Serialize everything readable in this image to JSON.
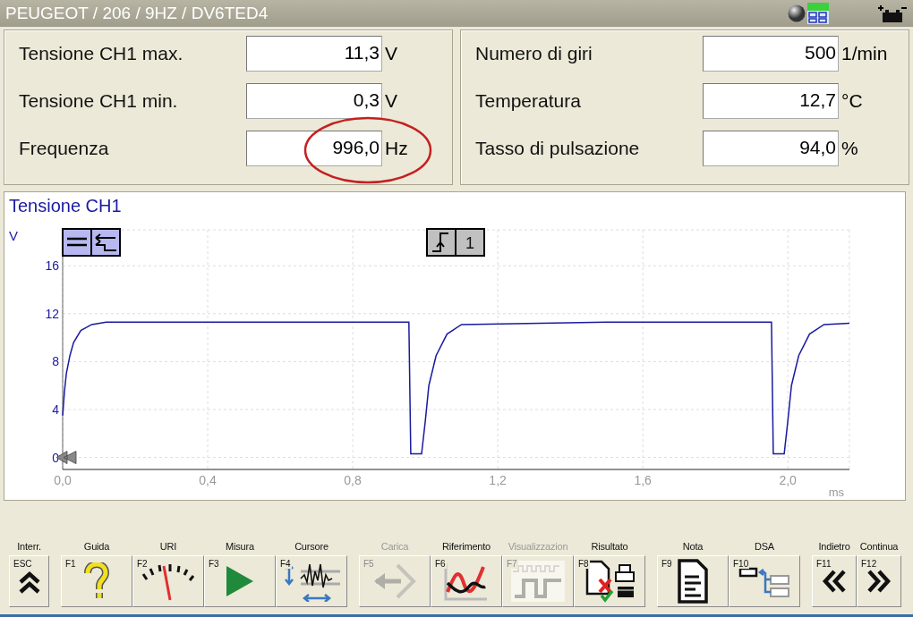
{
  "window": {
    "title": "PEUGEOT / 206 / 9HZ / DV6TED4"
  },
  "readings": [
    {
      "label": "Tensione CH1 max.",
      "value": "11,3",
      "unit": "V",
      "highlighted": false
    },
    {
      "label": "Tensione CH1 min.",
      "value": "0,3",
      "unit": "V",
      "highlighted": false
    },
    {
      "label": "Frequenza",
      "value": "996,0",
      "unit": "Hz",
      "highlighted": true
    },
    {
      "label": "Numero di giri",
      "value": "500",
      "unit": "1/min",
      "highlighted": false
    },
    {
      "label": "Temperatura",
      "value": "12,7",
      "unit": "°C",
      "highlighted": false
    },
    {
      "label": "Tasso di pulsazione",
      "value": "94,0",
      "unit": "%",
      "highlighted": false
    }
  ],
  "chart": {
    "trigger_channel": "1",
    "chart_data": {
      "type": "line",
      "title": "Tensione CH1",
      "xlabel": "ms",
      "ylabel": "V",
      "x": [
        0,
        0.005,
        0.01,
        0.02,
        0.03,
        0.05,
        0.08,
        0.12,
        0.5,
        0.95,
        0.955,
        0.96,
        0.98,
        0.99,
        1.0,
        1.01,
        1.03,
        1.06,
        1.1,
        1.5,
        1.955,
        1.96,
        1.98,
        1.99,
        2.0,
        2.01,
        2.03,
        2.06,
        2.1,
        2.17
      ],
      "grid": true,
      "series": [
        {
          "color": "#1a1aa0",
          "values": [
            3.5,
            5.5,
            7,
            8.5,
            9.6,
            10.6,
            11.1,
            11.3,
            11.3,
            11.3,
            11.3,
            0.3,
            0.3,
            0.3,
            3,
            6,
            8.5,
            10.3,
            11.1,
            11.3,
            11.3,
            0.3,
            0.3,
            0.3,
            3,
            6,
            8.5,
            10.3,
            11.1,
            11.2
          ]
        }
      ],
      "xlim": [
        0,
        2.17
      ],
      "ylim": [
        -1,
        19
      ],
      "xticks": [
        {
          "value": 0,
          "label": "0,0"
        },
        {
          "value": 0.4,
          "label": "0,4"
        },
        {
          "value": 0.8,
          "label": "0,8"
        },
        {
          "value": 1.2,
          "label": "1,2"
        },
        {
          "value": 1.6,
          "label": "1,6"
        },
        {
          "value": 2.0,
          "label": "2,0"
        }
      ],
      "yticks": [
        0,
        4,
        8,
        12,
        16
      ]
    }
  },
  "function_keys": [
    [
      {
        "label": "Interr.",
        "key": "ESC",
        "disabled": false
      }
    ],
    [
      {
        "label": "Guida",
        "key": "F1",
        "disabled": false
      },
      {
        "label": "URI",
        "key": "F2",
        "disabled": false
      },
      {
        "label": "Misura",
        "key": "F3",
        "disabled": false
      },
      {
        "label": "Cursore",
        "key": "F4",
        "disabled": false
      }
    ],
    [
      {
        "label": "Carica",
        "key": "F5",
        "disabled": true
      },
      {
        "label": "Riferimento",
        "key": "F6",
        "disabled": false
      },
      {
        "label": "Visualizzazion",
        "key": "F7",
        "disabled": true
      },
      {
        "label": "Risultato",
        "key": "F8",
        "disabled": false
      }
    ],
    [
      {
        "label": "Nota",
        "key": "F9",
        "disabled": false
      },
      {
        "label": "DSA",
        "key": "F10",
        "disabled": false
      }
    ],
    [
      {
        "label": "Indietro",
        "key": "F11",
        "disabled": false
      },
      {
        "label": "Continua",
        "key": "F12",
        "disabled": false
      }
    ]
  ]
}
